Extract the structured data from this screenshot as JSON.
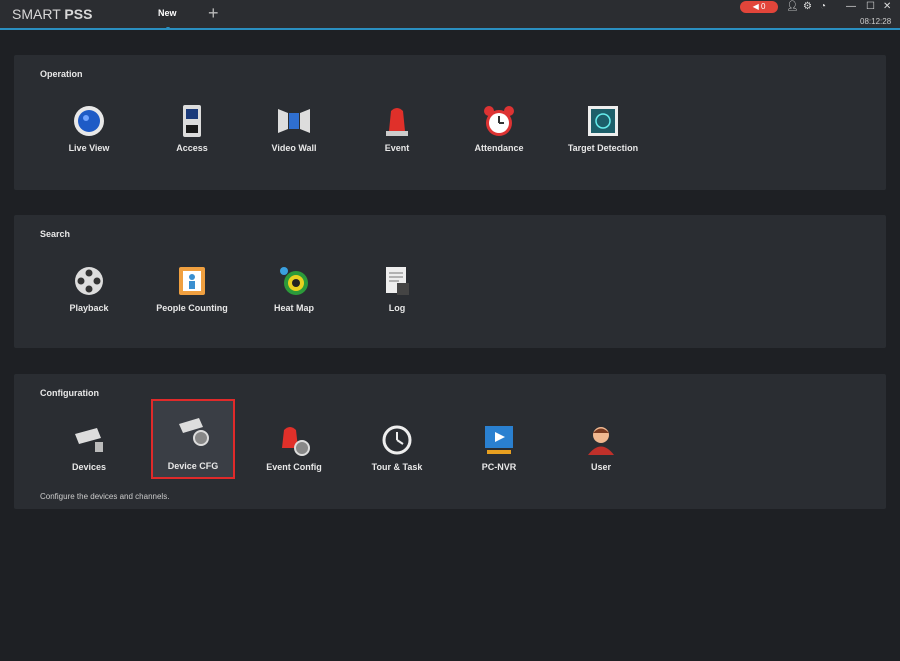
{
  "app": {
    "title_light": "SMART ",
    "title_bold": "PSS",
    "tab": "New",
    "add_tab": "+",
    "alarm_count": "0",
    "time": "08:12:28"
  },
  "sections": [
    {
      "title": "Operation",
      "items": [
        "Live View",
        "Access",
        "Video Wall",
        "Event",
        "Attendance",
        "Target Detection"
      ]
    },
    {
      "title": "Search",
      "items": [
        "Playback",
        "People Counting",
        "Heat Map",
        "Log"
      ]
    },
    {
      "title": "Configuration",
      "items": [
        "Devices",
        "Device CFG",
        "Event Config",
        "Tour & Task",
        "PC-NVR",
        "User"
      ],
      "hint": "Configure the devices and channels."
    }
  ],
  "selected": "Device CFG",
  "colors": {
    "accent": "#2a8fc0",
    "alarm": "#e2453a",
    "selection": "#e02a2a"
  }
}
